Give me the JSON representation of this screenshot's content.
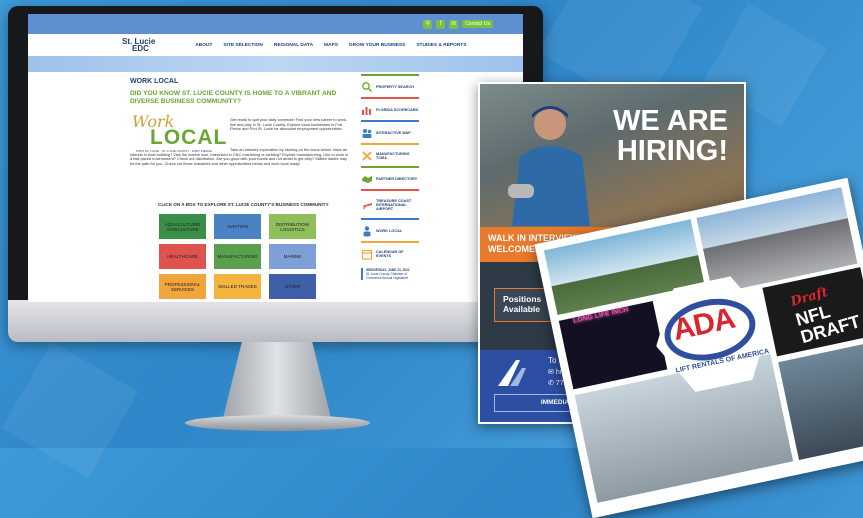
{
  "site": {
    "logo_line1": "St. Lucie",
    "logo_line2": "EDC",
    "contact": "Contact Us",
    "social": [
      "f",
      "in"
    ],
    "nav": [
      "ABOUT",
      "SITE SELECTION",
      "REGIONAL DATA",
      "MAPS",
      "GROW YOUR BUSINESS",
      "STUDIES & REPORTS"
    ]
  },
  "page": {
    "title": "WORK LOCAL",
    "question": "DID YOU KNOW ST. LUCIE COUNTY IS HOME TO A VIBRANT AND DIVERSE BUSINESS COMMUNITY?",
    "logo_work": "Work",
    "logo_local": "LOCAL",
    "logo_tag": "PORT ST. LUCIE · ST. LUCIE COUNTY · FORT PIERCE",
    "para1": "Get ready to quit your daily commute! Find your new career to work, live and play in St. Lucie County. Explore local businesses in Fort Pierce and Port St. Lucie for abundant employment opportunities.",
    "para2": "Take an industry exploration by clicking on the icons below. Have an interest in boat building? Visit the marine icon. Interested in CNC machining or welding? Explore manufacturing. Like to work in a fast paced environment? Check out distribution. Are you good with your hands and not afraid to get dirty? Skilled trades may be the path for you. Check out these industries and other opportunities below and work local today!",
    "cta": "CLICK ON A BOX TO EXPLORE ST. LUCIE COUNTY'S BUSINESS COMMUNITY"
  },
  "tiles": [
    {
      "label": "AQUACULTURE/ AGRICULTURE",
      "color": "#3a8f47"
    },
    {
      "label": "AVIATION",
      "color": "#4a83c4"
    },
    {
      "label": "DISTRIBUTION/ LOGISTICS",
      "color": "#8fbf5a"
    },
    {
      "label": "HEALTHCARE",
      "color": "#e0524d"
    },
    {
      "label": "MANUFACTURING",
      "color": "#5aa04c"
    },
    {
      "label": "MARINE",
      "color": "#7ea0d6"
    },
    {
      "label": "PROFESSIONAL SERVICES",
      "color": "#f0a63a"
    },
    {
      "label": "SKILLED TRADES",
      "color": "#f3b53f"
    },
    {
      "label": "OTHER",
      "color": "#3f5fa8"
    }
  ],
  "sidebar": [
    {
      "label": "PROPERTY SEARCH",
      "icon": "search-icon",
      "color": "#6aa632"
    },
    {
      "label": "FLORIDA SCORECARD",
      "icon": "chart-icon",
      "color": "#e0524d"
    },
    {
      "label": "INTERACTIVE MAP",
      "icon": "people-icon",
      "color": "#3d7bc7"
    },
    {
      "label": "MANUFACTURING TCMA",
      "icon": "tools-icon",
      "color": "#f0a63a"
    },
    {
      "label": "PARTNER DIRECTORY",
      "icon": "handshake-icon",
      "color": "#6aa632"
    },
    {
      "label": "TREASURE COAST INTERNATIONAL AIRPORT",
      "icon": "plane-icon",
      "color": "#e0524d"
    },
    {
      "label": "WORK LOCAL",
      "icon": "person-icon",
      "color": "#3d7bc7"
    },
    {
      "label": "CALENDAR OF EVENTS",
      "icon": "calendar-icon",
      "color": "#f0a63a"
    }
  ],
  "news": {
    "date": "WEDNESDAY, JUNE 23, 2021",
    "text": "St. Lucie County Chamber of Commerce Annual Legislative"
  },
  "ad_hiring": {
    "headline1": "WE ARE",
    "headline2": "HIRING!",
    "walk1": "WALK IN INTERVIEWS",
    "walk2": "WELCOMED",
    "positions1": "Positions",
    "positions2": "Available",
    "schedule": "To Sch",
    "email_prefix": "hr@",
    "phone_prefix": "77",
    "immediate": "IMMEDIA"
  },
  "ad_ada": {
    "logo": "ADA",
    "subtitle": "LIFT RENTALS OF AMERICA",
    "nfl_word": "NFL",
    "nfl_script": "Draft",
    "nfl_word2": "DRAFT",
    "neon": "LONG LIFE INCH"
  }
}
